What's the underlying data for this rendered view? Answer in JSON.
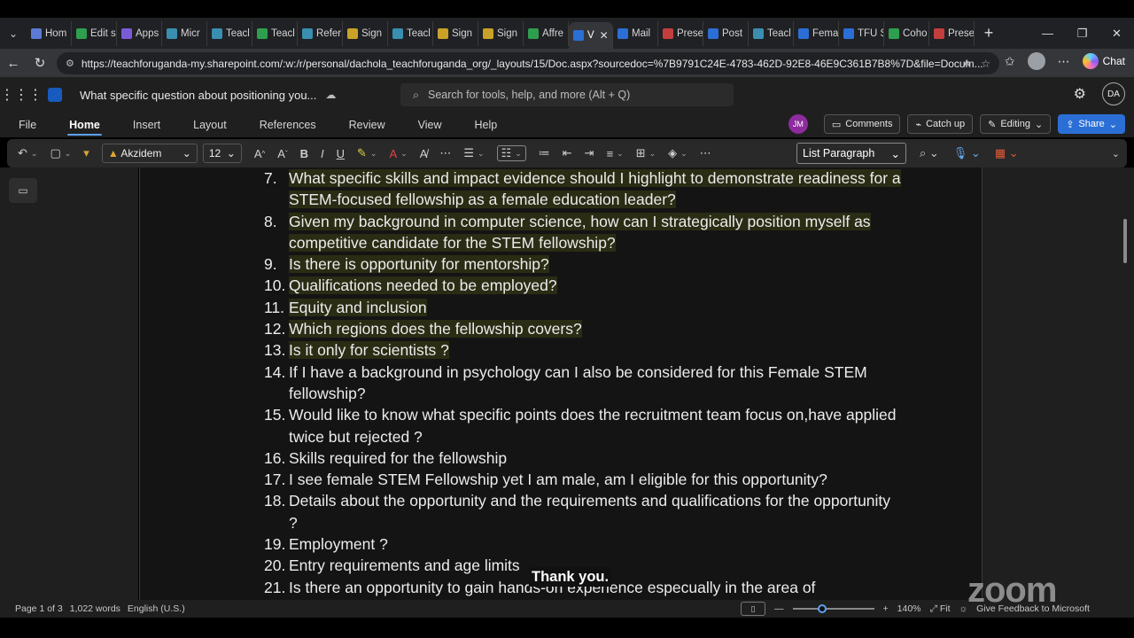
{
  "browser": {
    "tabs": [
      {
        "label": "Hom",
        "color": "#5b7bd5"
      },
      {
        "label": "Edit s",
        "color": "#2e9e4f"
      },
      {
        "label": "Apps",
        "color": "#7a5bd5"
      },
      {
        "label": "Micr",
        "color": "#3a8fb0"
      },
      {
        "label": "Teacl",
        "color": "#3a8fb0"
      },
      {
        "label": "Teacl",
        "color": "#2e9e4f"
      },
      {
        "label": "Refer",
        "color": "#3a8fb0"
      },
      {
        "label": "Sign",
        "color": "#c9a227"
      },
      {
        "label": "Teacl",
        "color": "#3a8fb0"
      },
      {
        "label": "Sign",
        "color": "#c9a227"
      },
      {
        "label": "Sign",
        "color": "#c9a227"
      },
      {
        "label": "Affre",
        "color": "#2e9e4f"
      },
      {
        "label": "V",
        "color": "#2b6fd6",
        "active": true
      },
      {
        "label": "Mail",
        "color": "#2b6fd6"
      },
      {
        "label": "Prese",
        "color": "#c43e3e"
      },
      {
        "label": "Post",
        "color": "#2b6fd6"
      },
      {
        "label": "Teacl",
        "color": "#3a8fb0"
      },
      {
        "label": "Fema",
        "color": "#2b6fd6"
      },
      {
        "label": "TFU S",
        "color": "#2b6fd6"
      },
      {
        "label": "Coho",
        "color": "#2e9e4f"
      },
      {
        "label": "Prese",
        "color": "#c43e3e"
      }
    ],
    "url": "https://teachforuganda-my.sharepoint.com/:w:/r/personal/dachola_teachforuganda_org/_layouts/15/Doc.aspx?sourcedoc=%7B9791C24E-4783-462D-92E8-46E9C361B7B8%7D&file=Docum...",
    "chat_label": "Chat"
  },
  "word": {
    "doc_title": "What specific question about positioning you...",
    "search_placeholder": "Search for tools, help, and more (Alt + Q)",
    "avatar_initials": "DA",
    "ribbon_tabs": [
      "File",
      "Home",
      "Insert",
      "Layout",
      "References",
      "Review",
      "View",
      "Help"
    ],
    "active_tab": "Home",
    "coauthor_initials": "JM",
    "comments_label": "Comments",
    "catchup_label": "Catch up",
    "editing_label": "Editing",
    "share_label": "Share",
    "font_name": "Akzidem",
    "font_size": "12",
    "style_name": "List Paragraph"
  },
  "document": {
    "items": [
      {
        "num": "7.",
        "text": "What specific skills and impact evidence should I highlight to demonstrate readiness for a STEM-focused fellowship as a female education leader?",
        "highlight": true
      },
      {
        "num": "8.",
        "text": "Given my background in computer science, how can I strategically position myself as competitive candidate for the STEM fellowship?",
        "highlight": true
      },
      {
        "num": "9.",
        "text": "Is there is opportunity for mentorship?",
        "highlight": true
      },
      {
        "num": "10.",
        "text": "Qualifications needed to be employed?",
        "highlight": true
      },
      {
        "num": "11.",
        "text": "Equity and inclusion",
        "highlight": true
      },
      {
        "num": "12.",
        "text": "Which regions does the fellowship covers?",
        "highlight": true
      },
      {
        "num": "13.",
        "text": "Is it only for scientists ?",
        "highlight": true
      },
      {
        "num": "14.",
        "text": "If I have a background in psychology can I also be considered for this Female STEM fellowship?",
        "highlight": false
      },
      {
        "num": "15.",
        "text": "Would like to know what specific points does the recruitment team focus on,have applied twice but rejected ?",
        "highlight": false
      },
      {
        "num": "16.",
        "text": "Skills  required  for the fellowship",
        "highlight": false
      },
      {
        "num": "17.",
        "text": "I see female STEM Fellowship yet I am male, am I eligible for this opportunity?",
        "highlight": false
      },
      {
        "num": "18.",
        "text": "Details about the opportunity and the requirements and qualifications for the opportunity ?",
        "highlight": false
      },
      {
        "num": "19.",
        "text": "Employment ?",
        "highlight": false
      },
      {
        "num": "20.",
        "text": "Entry requirements and age limits",
        "highlight": false
      },
      {
        "num": "21.",
        "text": "Is there an opportunity to gain hands-on experience especually in the area of",
        "highlight": false
      }
    ]
  },
  "status": {
    "page": "Page 1 of 3",
    "words": "1,022 words",
    "language": "English (U.S.)",
    "zoom": "140%",
    "fit_label": "Fit",
    "feedback": "Give Feedback to Microsoft"
  },
  "overlay": {
    "caption": "Thank you.",
    "watermark": "zoom"
  }
}
